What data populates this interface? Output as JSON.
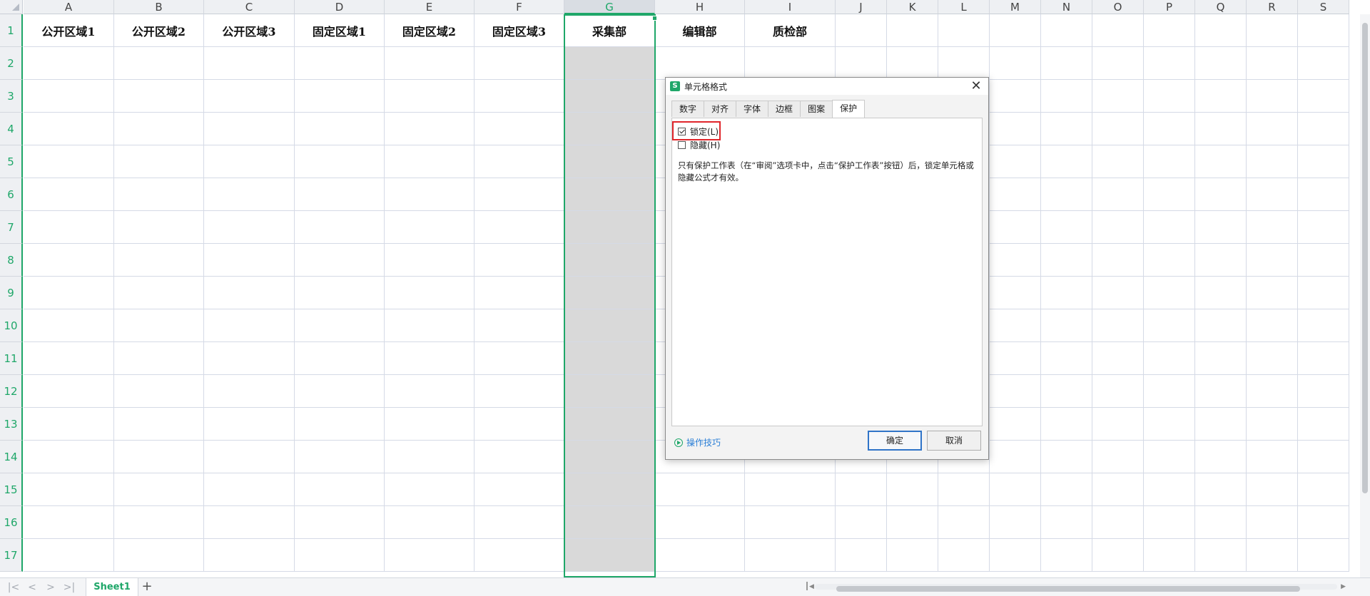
{
  "sheet": {
    "columns": [
      "A",
      "B",
      "C",
      "D",
      "E",
      "F",
      "G",
      "H",
      "I",
      "J",
      "K",
      "L",
      "M",
      "N",
      "O",
      "P",
      "Q",
      "R",
      "S"
    ],
    "selected_column": "G",
    "rows": [
      "1",
      "2",
      "3",
      "4",
      "5",
      "6",
      "7",
      "8",
      "9",
      "10",
      "11",
      "12",
      "13",
      "14",
      "15",
      "16",
      "17"
    ],
    "row1_values": [
      "公开区域1",
      "公开区域2",
      "公开区域3",
      "固定区域1",
      "固定区域2",
      "固定区域3",
      "采集部",
      "编辑部",
      "质检部",
      "",
      "",
      "",
      "",
      "",
      "",
      "",
      "",
      "",
      ""
    ],
    "accent_color": "#1fa769"
  },
  "bottom": {
    "sheet_tab": "Sheet1",
    "add_icon": "plus-icon",
    "nav_icons": [
      "first-sheet-icon",
      "prev-sheet-icon",
      "next-sheet-icon",
      "last-sheet-icon"
    ]
  },
  "dialog": {
    "title": "单元格格式",
    "tabs": [
      "数字",
      "对齐",
      "字体",
      "边框",
      "图案",
      "保护"
    ],
    "active_tab": "保护",
    "lock_label": "锁定(L)",
    "lock_checked": true,
    "hide_label": "隐藏(H)",
    "hide_checked": false,
    "note": "只有保护工作表（在“审阅”选项卡中，点击“保护工作表”按钮）后，锁定单元格或隐藏公式才有效。",
    "tips_label": "操作技巧",
    "ok_label": "确定",
    "cancel_label": "取消",
    "highlight_color": "#e0262b"
  }
}
